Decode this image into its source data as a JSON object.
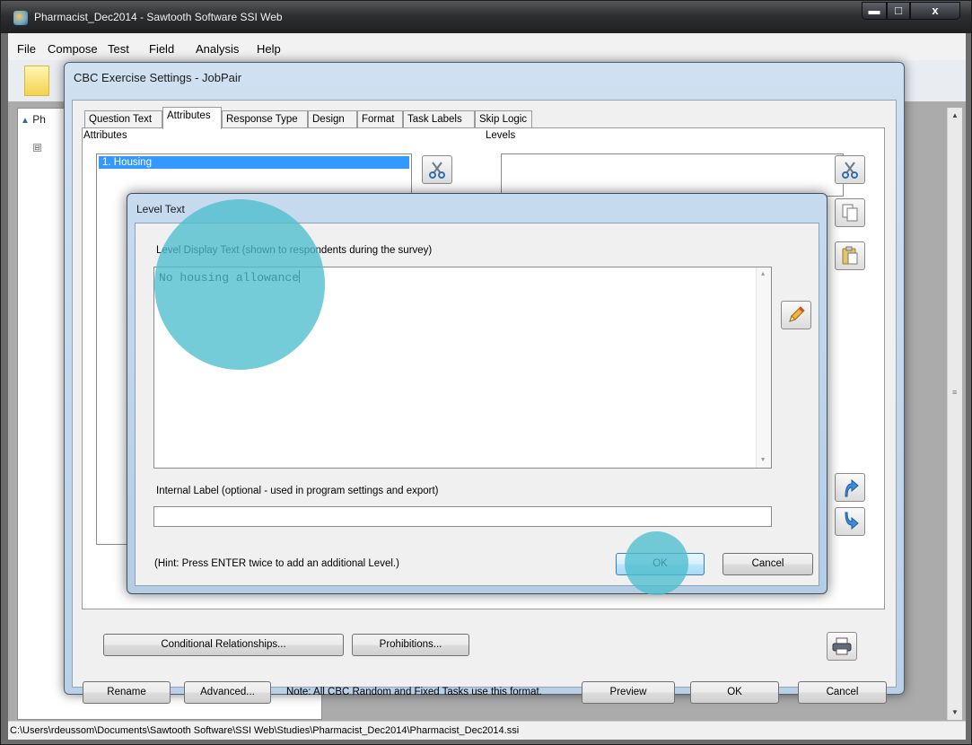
{
  "app": {
    "title": "Pharmacist_Dec2014 - Sawtooth Software SSI Web",
    "window_buttons": {
      "minimize": "▬",
      "maximize": "□",
      "close": "x"
    }
  },
  "menu": [
    "File",
    "Compose",
    "Test",
    "Field",
    "Analysis",
    "Help"
  ],
  "left_pane": {
    "tab_label": "Ph",
    "tree_toggle": "⊟"
  },
  "status_bar": "C:\\Users\\rdeussom\\Documents\\Sawtooth Software\\SSI Web\\Studies\\Pharmacist_Dec2014\\Pharmacist_Dec2014.ssi",
  "cbc_dialog": {
    "title": "CBC Exercise Settings - JobPair",
    "tabs": [
      "Question Text",
      "Attributes",
      "Response Type",
      "Design",
      "Format",
      "Task Labels",
      "Skip Logic"
    ],
    "active_tab": "Attributes",
    "attributes_label": "Attributes",
    "levels_label": "Levels",
    "attributes": [
      "1. Housing"
    ],
    "selected_attribute": "1. Housing",
    "buttons": {
      "conditional": "Conditional Relationships...",
      "prohibitions": "Prohibitions...",
      "rename": "Rename",
      "advanced": "Advanced...",
      "preview": "Preview",
      "ok": "OK",
      "cancel": "Cancel"
    },
    "note": "Note:  All CBC Random and Fixed Tasks use this format."
  },
  "level_dialog": {
    "title": "Level Text",
    "display_label": "Level Display Text (shown to respondents during the survey)",
    "display_value": "No housing allowance",
    "internal_label": "Internal Label (optional - used in program settings and export)",
    "internal_value": "",
    "hint": "(Hint: Press ENTER twice to add an additional Level.)",
    "ok": "OK",
    "cancel": "Cancel"
  },
  "icons": [
    "cut-icon",
    "copy-icon",
    "paste-icon",
    "edit-pencil-icon",
    "arrow-up-icon",
    "arrow-down-icon",
    "print-icon"
  ],
  "colors": {
    "selection": "#3399ff",
    "touch_indicator": "#4cbecd",
    "title_bar": "#2d2f31"
  }
}
